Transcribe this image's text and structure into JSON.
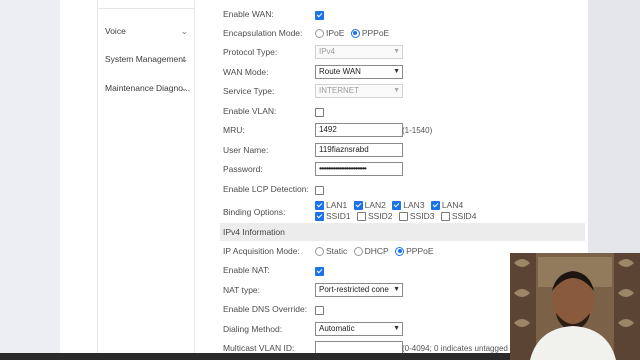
{
  "sidebar": {
    "items": [
      {
        "label": "Voice"
      },
      {
        "label": "System Management"
      },
      {
        "label": "Maintenance Diagno..."
      }
    ]
  },
  "form": {
    "enable_wan": {
      "label": "Enable WAN:",
      "checked": true
    },
    "encapsulation": {
      "label": "Encapsulation Mode:",
      "options": [
        "IPoE",
        "PPPoE"
      ],
      "selected": "PPPoE"
    },
    "protocol_type": {
      "label": "Protocol Type:",
      "value": "IPv4"
    },
    "wan_mode": {
      "label": "WAN Mode:",
      "value": "Route WAN"
    },
    "service_type": {
      "label": "Service Type:",
      "value": "INTERNET"
    },
    "enable_vlan": {
      "label": "Enable VLAN:",
      "checked": false
    },
    "mru": {
      "label": "MRU:",
      "value": "1492",
      "hint": "(1-1540)"
    },
    "user_name": {
      "label": "User Name:",
      "value": "119fiaznsrabd"
    },
    "password": {
      "label": "Password:",
      "value": "••••••••••••••••••••••••••"
    },
    "enable_lcp": {
      "label": "Enable LCP Detection:",
      "checked": false
    },
    "binding": {
      "label": "Binding Options:",
      "row1": [
        {
          "label": "LAN1",
          "checked": true
        },
        {
          "label": "LAN2",
          "checked": true
        },
        {
          "label": "LAN3",
          "checked": true
        },
        {
          "label": "LAN4",
          "checked": true
        }
      ],
      "row2": [
        {
          "label": "SSID1",
          "checked": true
        },
        {
          "label": "SSID2",
          "checked": false
        },
        {
          "label": "SSID3",
          "checked": false
        },
        {
          "label": "SSID4",
          "checked": false
        }
      ]
    },
    "ipv4_section": {
      "label": "IPv4 Information"
    },
    "ip_acquisition": {
      "label": "IP Acquisition Mode:",
      "options": [
        "Static",
        "DHCP",
        "PPPoE"
      ],
      "selected": "PPPoE"
    },
    "enable_nat": {
      "label": "Enable NAT:",
      "checked": true
    },
    "nat_type": {
      "label": "NAT type:",
      "value": "Port-restricted cone"
    },
    "enable_dns_override": {
      "label": "Enable DNS Override:",
      "checked": false
    },
    "dialing_method": {
      "label": "Dialing Method:",
      "value": "Automatic"
    },
    "multicast_vlan": {
      "label": "Multicast VLAN ID:",
      "value": "",
      "hint": "(0-4094; 0 indicates untagged"
    }
  }
}
